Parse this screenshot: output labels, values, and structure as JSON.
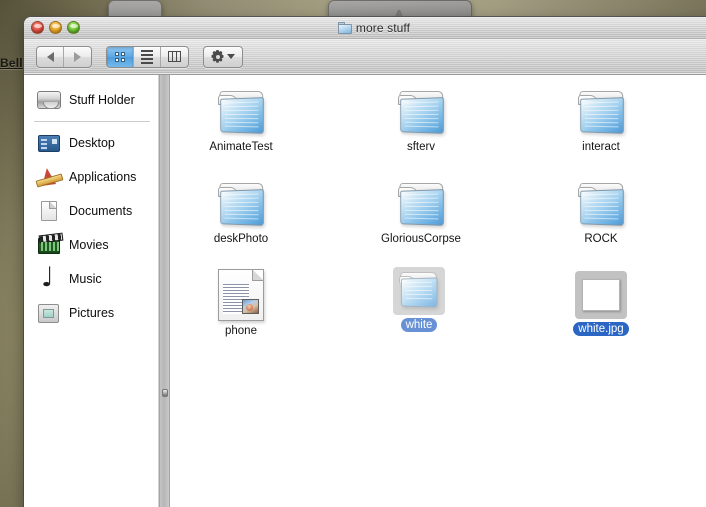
{
  "desktop": {
    "link_text": "Bell",
    "background_color": "#d3cda8"
  },
  "window": {
    "title": "more stuff",
    "title_icon": "folder-icon",
    "traffic_lights": {
      "close": "close-button",
      "minimize": "minimize-button",
      "zoom": "zoom-button"
    }
  },
  "toolbar": {
    "back": "back-button",
    "forward": "forward-button",
    "view_icon": "icon-view-button",
    "view_list": "list-view-button",
    "view_column": "column-view-button",
    "active_view": "icon",
    "action_menu": "action-gear-menu",
    "accent_color": "#5fa9e6"
  },
  "sidebar": {
    "items": [
      {
        "label": "Stuff Holder",
        "icon": "hard-disk-icon",
        "group": "devices"
      },
      {
        "label": "Desktop",
        "icon": "desktop-icon",
        "group": "places"
      },
      {
        "label": "Applications",
        "icon": "applications-icon",
        "group": "places"
      },
      {
        "label": "Documents",
        "icon": "documents-icon",
        "group": "places"
      },
      {
        "label": "Movies",
        "icon": "movies-icon",
        "group": "places"
      },
      {
        "label": "Music",
        "icon": "music-icon",
        "group": "places"
      },
      {
        "label": "Pictures",
        "icon": "pictures-icon",
        "group": "places"
      }
    ]
  },
  "content": {
    "items": [
      {
        "name": "AnimateTest",
        "kind": "folder",
        "selected": false
      },
      {
        "name": "sfterv",
        "kind": "folder",
        "selected": false
      },
      {
        "name": "interact",
        "kind": "folder",
        "selected": false
      },
      {
        "name": "deskPhoto",
        "kind": "folder",
        "selected": false
      },
      {
        "name": "GloriousCorpse",
        "kind": "folder",
        "selected": false
      },
      {
        "name": "ROCK",
        "kind": "folder",
        "selected": false
      },
      {
        "name": "phone",
        "kind": "document",
        "selected": false
      },
      {
        "name": "white.jpg",
        "kind": "image",
        "selected": true
      }
    ],
    "drag": {
      "label": "white",
      "kind": "folder",
      "in_progress": true
    },
    "selection_color": "#2c66c4"
  }
}
